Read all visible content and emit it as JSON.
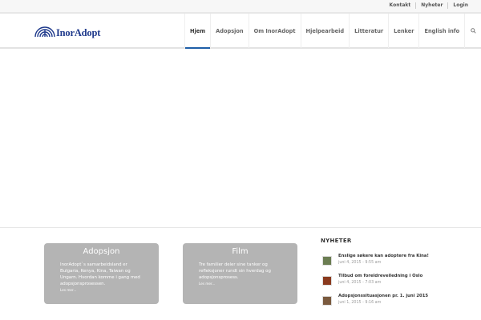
{
  "topbar": {
    "links": [
      "Kontakt",
      "Nyheter",
      "Login"
    ]
  },
  "logo": {
    "text": "InorAdopt"
  },
  "nav": {
    "items": [
      "Hjem",
      "Adopsjon",
      "Om InorAdopt",
      "Hjelpearbeid",
      "Litteratur",
      "Lenker",
      "English info"
    ],
    "active": "Hjem"
  },
  "cards": [
    {
      "title": "Adopsjon",
      "body": "InorAdopt`s samarbeidsland er Bulgaria, Kenya, Kina, Taiwan og Ungarn. Hvordan komme i gang med adopsjonsprosessen.",
      "more": "Les mer..."
    },
    {
      "title": "Film",
      "body": "Tre familier deler sine tanker og refleksjoner rundt sin hverdag og adopsjonsprosess.",
      "more": "Les mer..."
    }
  ],
  "news": {
    "heading": "NYHETER",
    "items": [
      {
        "title": "Enslige søkere kan adoptere fra Kina!",
        "date": "juni 4, 2015 - 9:55 am"
      },
      {
        "title": "Tilbud om foreldreveiledning i Oslo",
        "date": "juni 4, 2015 - 7:03 am"
      },
      {
        "title": "Adopsjonssituasjonen pr. 1. juni 2015",
        "date": "juni 1, 2015 - 9:16 am"
      }
    ]
  },
  "colors": {
    "brand": "#1f3a8c",
    "accent": "#1e5ea8",
    "card_bg": "#b4b4b4"
  }
}
